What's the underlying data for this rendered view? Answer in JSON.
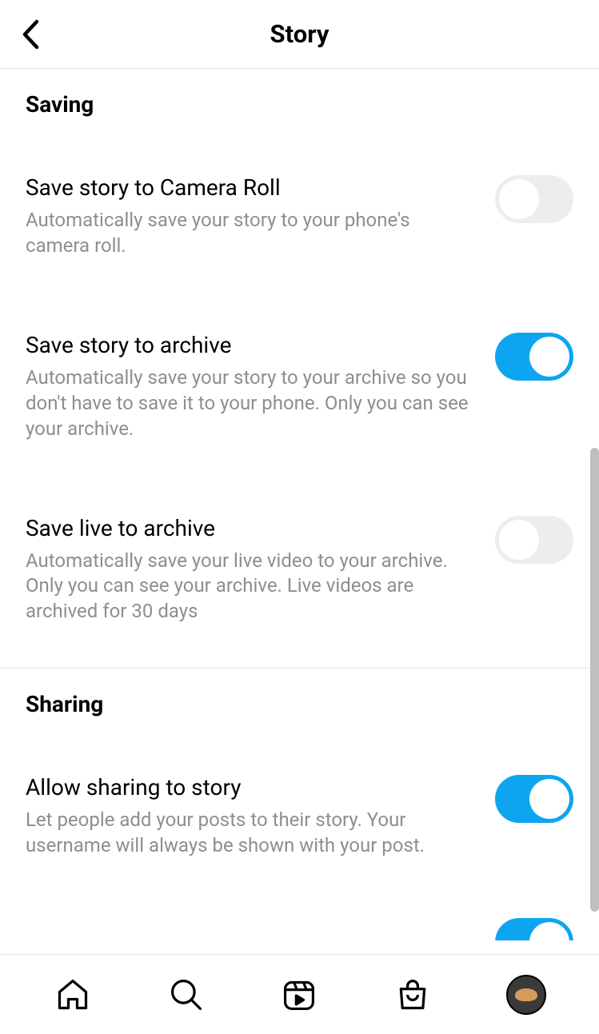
{
  "header": {
    "title": "Story"
  },
  "sections": {
    "saving": {
      "heading": "Saving",
      "rows": {
        "camera_roll": {
          "title": "Save story to Camera Roll",
          "desc": "Automatically save your story to your phone's camera roll.",
          "on": false
        },
        "story_archive": {
          "title": "Save story to archive",
          "desc": "Automatically save your story to your archive so you don't have to save it to your phone. Only you can see your archive.",
          "on": true
        },
        "live_archive": {
          "title": "Save live to archive",
          "desc": "Automatically save your live video to your archive. Only you can see your archive. Live videos are archived for 30 days",
          "on": false
        }
      }
    },
    "sharing": {
      "heading": "Sharing",
      "rows": {
        "allow_share_story": {
          "title": "Allow sharing to story",
          "desc": "Let people add your posts to their story. Your username will always be shown with your post.",
          "on": true
        }
      }
    }
  },
  "colors": {
    "accent": "#0ea5f0",
    "toggle_off": "#ededed",
    "desc_text": "#8e8e8e"
  }
}
